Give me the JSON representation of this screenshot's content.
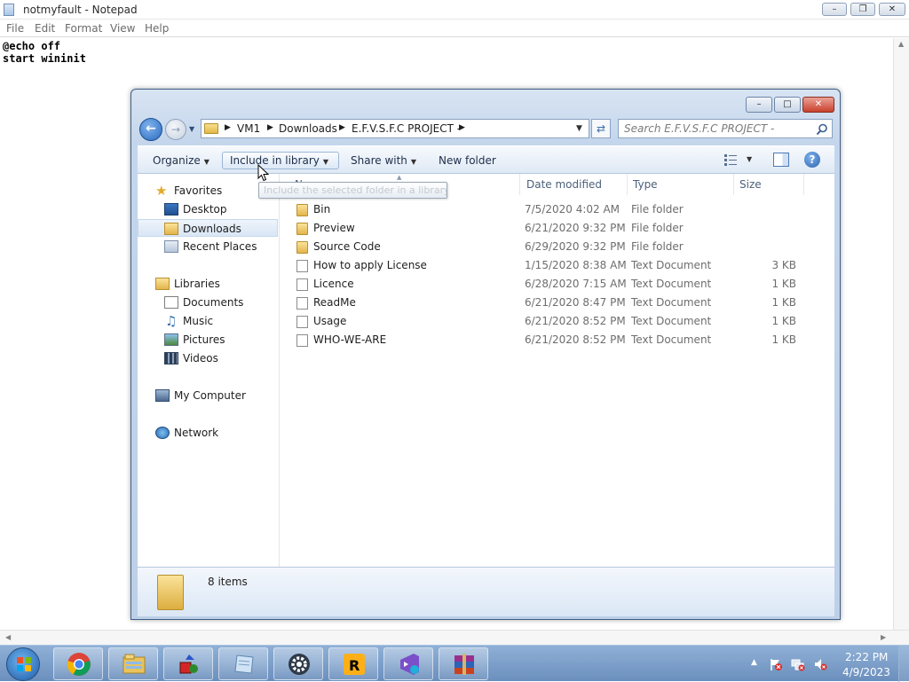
{
  "notepad": {
    "title": "notmyfault - Notepad",
    "menu": [
      "File",
      "Edit",
      "Format",
      "View",
      "Help"
    ],
    "lines": [
      "@echo off",
      "start wininit"
    ]
  },
  "explorer": {
    "breadcrumbs": [
      "VM1",
      "Downloads",
      "E.F.V.S.F.C PROJECT -"
    ],
    "search_placeholder": "Search E.F.V.S.F.C PROJECT -",
    "toolbar": {
      "organize": "Organize",
      "include_in_library": "Include in library",
      "share_with": "Share with",
      "new_folder": "New folder"
    },
    "tooltip": "Include the selected folder in a library.",
    "nav": {
      "favorites": "Favorites",
      "desktop": "Desktop",
      "downloads": "Downloads",
      "recent_places": "Recent Places",
      "libraries": "Libraries",
      "documents": "Documents",
      "music": "Music",
      "pictures": "Pictures",
      "videos": "Videos",
      "my_computer": "My Computer",
      "network": "Network"
    },
    "columns": {
      "name": "Name",
      "date_modified": "Date modified",
      "type": "Type",
      "size": "Size"
    },
    "files": [
      {
        "name": "Bin",
        "date": "7/5/2020 4:02 AM",
        "type": "File folder",
        "size": "",
        "icon": "folder-icon"
      },
      {
        "name": "Preview",
        "date": "6/21/2020 9:32 PM",
        "type": "File folder",
        "size": "",
        "icon": "folder-icon"
      },
      {
        "name": "Source Code",
        "date": "6/29/2020 9:32 PM",
        "type": "File folder",
        "size": "",
        "icon": "folder-icon"
      },
      {
        "name": "How to apply License",
        "date": "1/15/2020 8:38 AM",
        "type": "Text Document",
        "size": "3 KB",
        "icon": "text-document-icon"
      },
      {
        "name": "Licence",
        "date": "6/28/2020 7:15 AM",
        "type": "Text Document",
        "size": "1 KB",
        "icon": "text-document-icon"
      },
      {
        "name": "ReadMe",
        "date": "6/21/2020 8:47 PM",
        "type": "Text Document",
        "size": "1 KB",
        "icon": "text-document-icon"
      },
      {
        "name": "Usage",
        "date": "6/21/2020 8:52 PM",
        "type": "Text Document",
        "size": "1 KB",
        "icon": "text-document-icon"
      },
      {
        "name": "WHO-WE-ARE",
        "date": "6/21/2020 8:52 PM",
        "type": "Text Document",
        "size": "1 KB",
        "icon": "text-document-icon"
      }
    ],
    "item_count": "8 items"
  },
  "taskbar": {
    "apps": [
      "chrome-icon",
      "windows-explorer-icon",
      "3d-builder-icon",
      "notepad-icon",
      "settings-gear-icon",
      "rockstar-launcher-icon",
      "visual-studio-installer-icon",
      "winrar-icon"
    ],
    "clock_time": "2:22 PM",
    "clock_date": "4/9/2023"
  }
}
